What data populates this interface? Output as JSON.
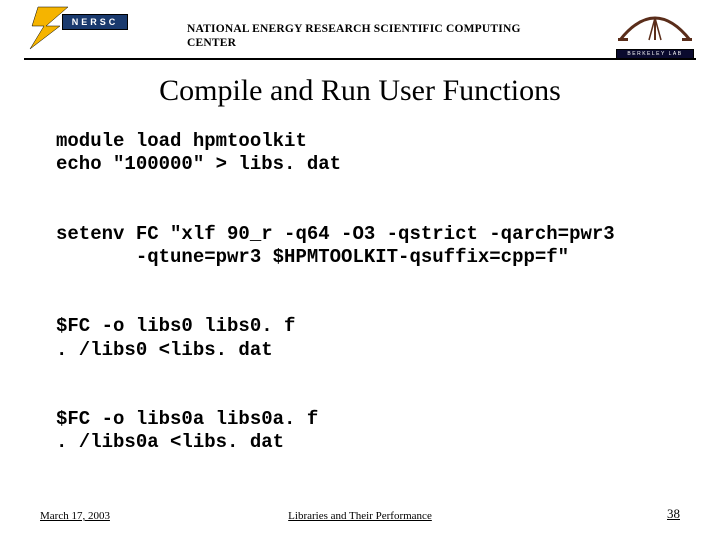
{
  "header": {
    "nersc_letters": "NERSC",
    "org_line1": "NATIONAL ENERGY RESEARCH SCIENTIFIC COMPUTING",
    "org_line2": "CENTER",
    "lab_label": "BERKELEY LAB"
  },
  "title": "Compile and Run User Functions",
  "code": "module load hpmtoolkit\necho \"100000\" > libs. dat\n\n\nsetenv FC \"xlf 90_r -q64 -O3 -qstrict -qarch=pwr3 \n       -qtune=pwr3 $HPMTOOLKIT-qsuffix=cpp=f\"\n\n\n$FC -o libs0 libs0. f\n. /libs0 <libs. dat\n\n\n$FC -o libs0a libs0a. f\n. /libs0a <libs. dat",
  "footer": {
    "date": "March 17, 2003",
    "caption": "Libraries and Their Performance",
    "page": "38"
  }
}
